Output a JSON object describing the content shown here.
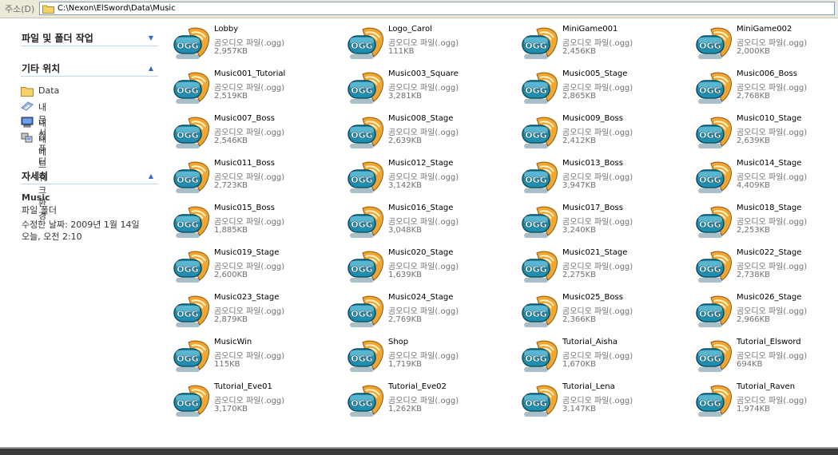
{
  "address": {
    "label": "주소(D)",
    "path": "C:\\Nexon\\ElSword\\Data\\Music"
  },
  "sidebar": {
    "file_folder_tasks": {
      "title": "파일 및 폴더 작업"
    },
    "other_places": {
      "title": "기타 위치",
      "items": [
        {
          "label": "Data",
          "icon": "folder-icon"
        },
        {
          "label": "내 문서",
          "icon": "my-documents-icon"
        },
        {
          "label": "내 컴퓨터",
          "icon": "my-computer-icon"
        },
        {
          "label": "내 네트워크 환경",
          "icon": "network-icon"
        }
      ]
    },
    "details": {
      "title": "자세히",
      "name": "Music",
      "type": "파일 폴더",
      "modified_line1": "수정한 날짜: 2009년 1월 14일",
      "modified_line2": "오늘, 오전 2:10"
    }
  },
  "file_type_label": "곰오디오 파일(.ogg)",
  "files": [
    {
      "name": "Lobby",
      "size": "2,957KB"
    },
    {
      "name": "Logo_Carol",
      "size": "111KB"
    },
    {
      "name": "MiniGame001",
      "size": "2,456KB"
    },
    {
      "name": "MiniGame002",
      "size": "2,000KB"
    },
    {
      "name": "Music001_Tutorial",
      "size": "2,519KB"
    },
    {
      "name": "Music003_Square",
      "size": "3,281KB"
    },
    {
      "name": "Music005_Stage",
      "size": "2,865KB"
    },
    {
      "name": "Music006_Boss",
      "size": "2,768KB"
    },
    {
      "name": "Music007_Boss",
      "size": "2,546KB"
    },
    {
      "name": "Music008_Stage",
      "size": "2,639KB"
    },
    {
      "name": "Music009_Boss",
      "size": "2,412KB"
    },
    {
      "name": "Music010_Stage",
      "size": "2,639KB"
    },
    {
      "name": "Music011_Boss",
      "size": "2,723KB"
    },
    {
      "name": "Music012_Stage",
      "size": "3,142KB"
    },
    {
      "name": "Music013_Boss",
      "size": "3,947KB"
    },
    {
      "name": "Music014_Stage",
      "size": "4,409KB"
    },
    {
      "name": "Music015_Boss",
      "size": "1,885KB"
    },
    {
      "name": "Music016_Stage",
      "size": "3,048KB"
    },
    {
      "name": "Music017_Boss",
      "size": "3,240KB"
    },
    {
      "name": "Music018_Stage",
      "size": "2,253KB"
    },
    {
      "name": "Music019_Stage",
      "size": "2,600KB"
    },
    {
      "name": "Music020_Stage",
      "size": "1,639KB"
    },
    {
      "name": "Music021_Stage",
      "size": "2,275KB"
    },
    {
      "name": "Music022_Stage",
      "size": "2,738KB"
    },
    {
      "name": "Music023_Stage",
      "size": "2,879KB"
    },
    {
      "name": "Music024_Stage",
      "size": "2,769KB"
    },
    {
      "name": "Music025_Boss",
      "size": "2,366KB"
    },
    {
      "name": "Music026_Stage",
      "size": "2,966KB"
    },
    {
      "name": "MusicWin",
      "size": "115KB"
    },
    {
      "name": "Shop",
      "size": "1,719KB"
    },
    {
      "name": "Tutorial_Aisha",
      "size": "1,670KB"
    },
    {
      "name": "Tutorial_Elsword",
      "size": "694KB"
    },
    {
      "name": "Tutorial_Eve01",
      "size": "3,170KB"
    },
    {
      "name": "Tutorial_Eve02",
      "size": "1,262KB"
    },
    {
      "name": "Tutorial_Lena",
      "size": "3,147KB"
    },
    {
      "name": "Tutorial_Raven",
      "size": "1,974KB"
    }
  ],
  "icon_text": "OGG",
  "colors": {
    "section_title": "#222222",
    "chevron": "#3a67c8",
    "ogg_teal": "#1f8fb0",
    "ogg_orange": "#f2a531"
  }
}
